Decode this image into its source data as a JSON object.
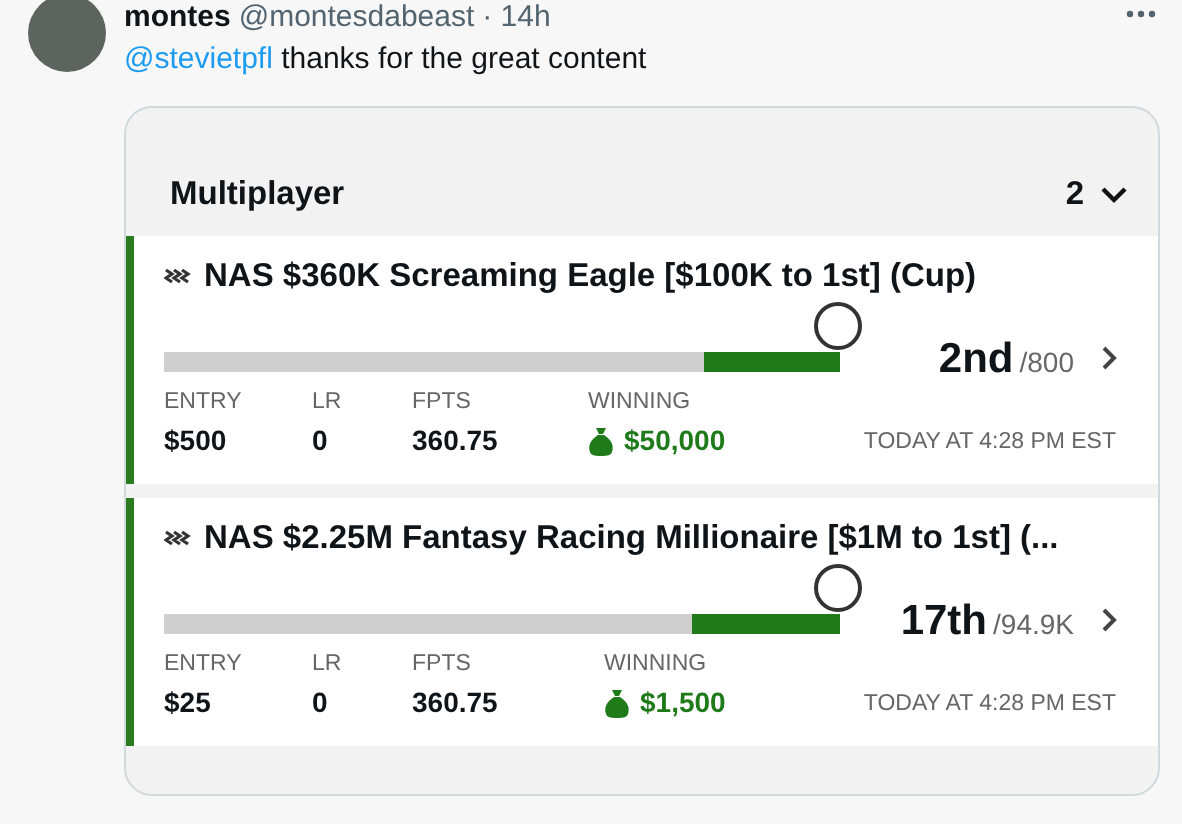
{
  "post": {
    "author": "montes",
    "handle": "@montesdabeast",
    "time": "· 14h",
    "mention": "@stevietpfl",
    "text": " thanks for the great content"
  },
  "panel": {
    "title": "Multiplayer",
    "count": "2"
  },
  "entries": [
    {
      "title": "NAS $360K Screaming Eagle [$100K to 1st] (Cup)",
      "level": 0.2,
      "rank": "2nd",
      "field": "/800",
      "stats": [
        {
          "label": "ENTRY",
          "value": "$500"
        },
        {
          "label": "LR",
          "value": "0"
        },
        {
          "label": "FPTS",
          "value": "360.75"
        }
      ],
      "winning_label": "WINNING",
      "winning": "$50,000",
      "timestamp": "TODAY AT 4:28 PM EST"
    },
    {
      "title": "NAS $2.25M Fantasy Racing Millionaire [$1M to 1st] (...",
      "level": 0.22,
      "rank": "17th",
      "field": "/94.9K",
      "stats": [
        {
          "label": "ENTRY",
          "value": "$25"
        },
        {
          "label": "LR",
          "value": "0"
        },
        {
          "label": "FPTS",
          "value": "360.75"
        }
      ],
      "winning_label": "WINNING",
      "winning": "$1,500",
      "timestamp": "TODAY AT 4:28 PM EST"
    }
  ]
}
